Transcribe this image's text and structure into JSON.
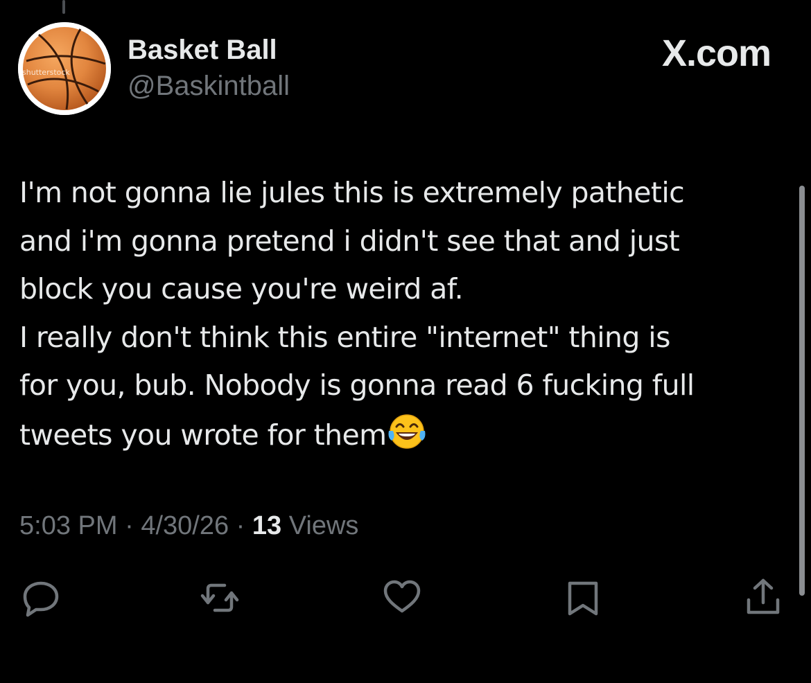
{
  "tweet": {
    "display_name": "Basket Ball",
    "handle": "@Baskintball",
    "brand": "X.com",
    "avatar_watermark": "shutterstock",
    "body_lines": [
      "I'm not gonna lie jules this is extremely pathetic",
      "and i'm gonna pretend i didn't see that and just",
      "block you cause you're weird af.",
      "I really don't think this entire \"internet\" thing is",
      "for you, bub. Nobody is gonna read 6 fucking full",
      "tweets you wrote for them"
    ],
    "emoji": "face-with-tears-of-joy",
    "time": "5:03 PM",
    "separator": "·",
    "date": "4/30/26",
    "views_count": "13",
    "views_label": "Views"
  },
  "actions": [
    {
      "name": "reply",
      "icon": "reply-icon"
    },
    {
      "name": "repost",
      "icon": "repost-icon"
    },
    {
      "name": "like",
      "icon": "heart-icon"
    },
    {
      "name": "bookmark",
      "icon": "bookmark-icon"
    },
    {
      "name": "share",
      "icon": "share-icon"
    }
  ],
  "colors": {
    "background": "#000000",
    "text_primary": "#e7e9ea",
    "text_secondary": "#71767b",
    "basketball": "#e2863f"
  }
}
